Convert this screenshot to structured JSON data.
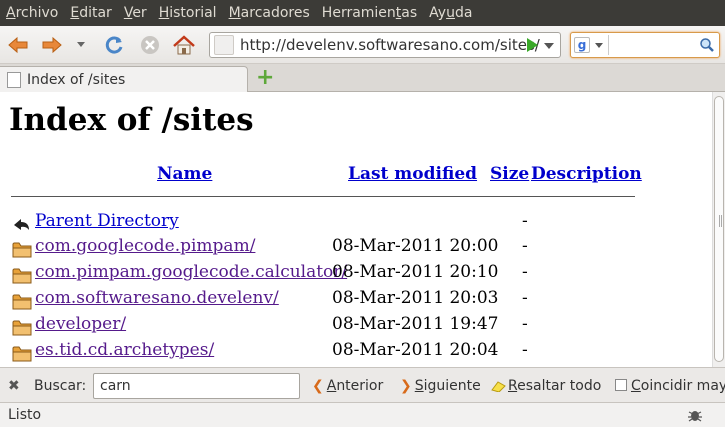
{
  "menu": [
    {
      "label": "Archivo",
      "key": "A",
      "rest": "rchivo"
    },
    {
      "label": "Editar",
      "key": "E",
      "rest": "ditar"
    },
    {
      "label": "Ver",
      "key": "V",
      "rest": "er"
    },
    {
      "label": "Historial",
      "key": "H",
      "rest": "istorial"
    },
    {
      "label": "Marcadores",
      "key": "M",
      "rest": "arcadores"
    },
    {
      "label": "Herramientas",
      "pre": "Herramien",
      "key": "t",
      "rest": "as"
    },
    {
      "label": "Ayuda",
      "pre": "Ay",
      "key": "u",
      "rest": "da"
    }
  ],
  "navbar": {
    "url": "http://develenv.softwaresano.com/sites/",
    "search_engine_letter": "g",
    "search_value": ""
  },
  "tab": {
    "title": "Index of /sites",
    "new_tab_symbol": "+"
  },
  "page": {
    "title": "Index of /sites",
    "headers": {
      "name": "Name",
      "modified": "Last modified",
      "size": "Size",
      "description": "Description"
    },
    "rows": [
      {
        "name": "Parent Directory",
        "date": "",
        "size": "-",
        "type": "parent"
      },
      {
        "name": "com.googlecode.pimpam/",
        "date": "08-Mar-2011 20:00",
        "size": "-",
        "type": "folder"
      },
      {
        "name": "com.pimpam.googlecode.calculator/",
        "date": "08-Mar-2011 20:10",
        "size": "-",
        "type": "folder"
      },
      {
        "name": "com.softwaresano.develenv/",
        "date": "08-Mar-2011 20:03",
        "size": "-",
        "type": "folder"
      },
      {
        "name": "developer/",
        "date": "08-Mar-2011 19:47",
        "size": "-",
        "type": "folder"
      },
      {
        "name": "es.tid.cd.archetypes/",
        "date": "08-Mar-2011 20:04",
        "size": "-",
        "type": "folder"
      }
    ]
  },
  "findbar": {
    "close": "✖",
    "label": "Buscar:",
    "value": "carn",
    "previous": {
      "key": "A",
      "rest": "nterior"
    },
    "next": {
      "key": "S",
      "rest": "iguiente"
    },
    "highlight": {
      "key": "R",
      "rest": "esaltar todo"
    },
    "match_case": {
      "key": "C",
      "rest": "oincidir mayú"
    }
  },
  "status": {
    "text": "Listo"
  },
  "colors": {
    "menubar_bg": "#3c3b37",
    "link": "#0000cc",
    "visited": "#551a8b",
    "folder": "#e8a23a",
    "accent": "#3aa829"
  }
}
